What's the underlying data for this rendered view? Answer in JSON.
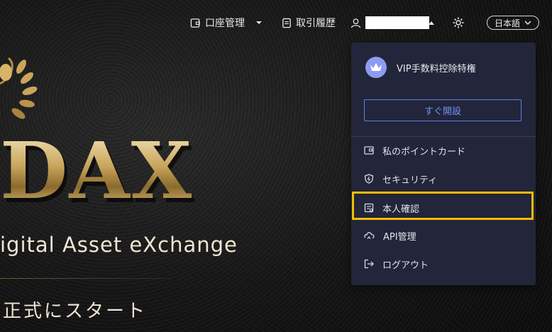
{
  "nav": {
    "account_management": "口座管理",
    "trade_history": "取引履歴",
    "language": "日本語"
  },
  "hero": {
    "logo": "DAX",
    "tagline": "igital Asset eXchange",
    "subtitle": "正式にスタート"
  },
  "dropdown": {
    "vip_label": "VIP手数料控除特権",
    "open_button": "すぐ開設",
    "items": [
      {
        "label": "私のポイントカード",
        "icon": "card-icon"
      },
      {
        "label": "セキュリティ",
        "icon": "shield-icon"
      },
      {
        "label": "本人確認",
        "icon": "id-card-icon"
      },
      {
        "label": "API管理",
        "icon": "api-icon"
      },
      {
        "label": "ログアウト",
        "icon": "logout-icon"
      }
    ]
  },
  "colors": {
    "highlight": "#f5bd00",
    "accent": "#5b7ee6",
    "dropdown_bg": "#23253a"
  }
}
